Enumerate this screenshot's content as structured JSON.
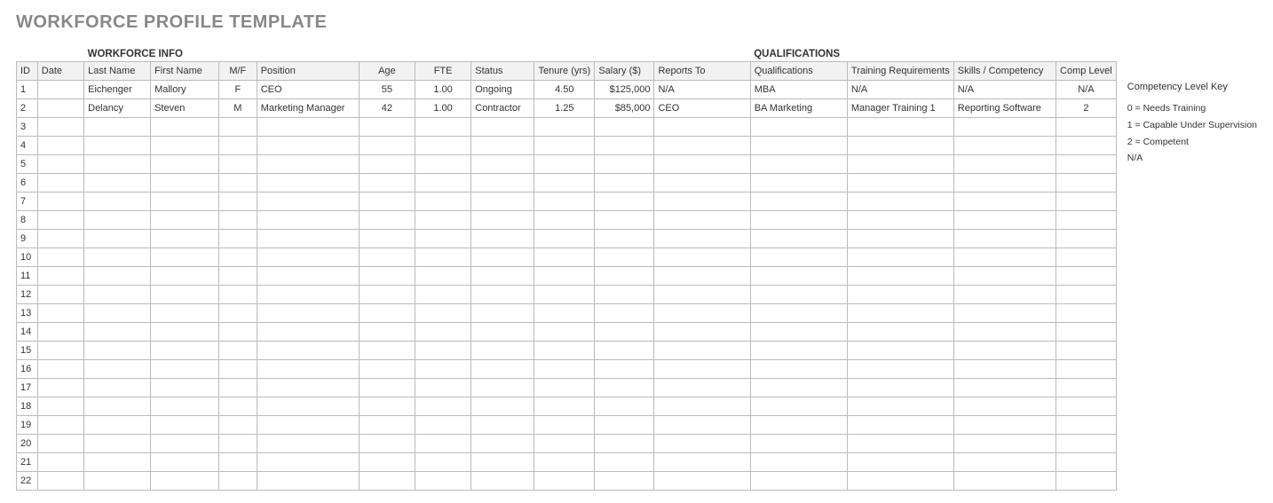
{
  "title": "WORKFORCE PROFILE TEMPLATE",
  "sections": {
    "workforce": "WORKFORCE INFO",
    "qualifications": "QUALIFICATIONS"
  },
  "headers": {
    "id": "ID",
    "date": "Date",
    "last": "Last Name",
    "first": "First Name",
    "mf": "M/F",
    "pos": "Position",
    "age": "Age",
    "fte": "FTE",
    "status": "Status",
    "tenure": "Tenure (yrs)",
    "salary": "Salary ($)",
    "reports": "Reports To",
    "qual": "Qualifications",
    "train": "Training Requirements",
    "skills": "Skills / Competency",
    "comp": "Comp Level"
  },
  "rows": [
    {
      "id": "1",
      "date": "",
      "last": "Eichenger",
      "first": "Mallory",
      "mf": "F",
      "pos": "CEO",
      "age": "55",
      "fte": "1.00",
      "status": "Ongoing",
      "tenure": "4.50",
      "salary": "$125,000",
      "reports": "N/A",
      "qual": "MBA",
      "train": "N/A",
      "skills": "N/A",
      "comp": "N/A"
    },
    {
      "id": "2",
      "date": "",
      "last": "Delancy",
      "first": "Steven",
      "mf": "M",
      "pos": "Marketing Manager",
      "age": "42",
      "fte": "1.00",
      "status": "Contractor",
      "tenure": "1.25",
      "salary": "$85,000",
      "reports": "CEO",
      "qual": "BA Marketing",
      "train": "Manager Training 1",
      "skills": "Reporting Software",
      "comp": "2"
    },
    {
      "id": "3"
    },
    {
      "id": "4"
    },
    {
      "id": "5"
    },
    {
      "id": "6"
    },
    {
      "id": "7"
    },
    {
      "id": "8"
    },
    {
      "id": "9"
    },
    {
      "id": "10"
    },
    {
      "id": "11"
    },
    {
      "id": "12"
    },
    {
      "id": "13"
    },
    {
      "id": "14"
    },
    {
      "id": "15"
    },
    {
      "id": "16"
    },
    {
      "id": "17"
    },
    {
      "id": "18"
    },
    {
      "id": "19"
    },
    {
      "id": "20"
    },
    {
      "id": "21"
    },
    {
      "id": "22"
    }
  ],
  "legend": {
    "title": "Competency Level Key",
    "items": [
      "0 = Needs Training",
      "1 = Capable Under Supervision",
      "2 = Competent",
      "N/A"
    ]
  }
}
